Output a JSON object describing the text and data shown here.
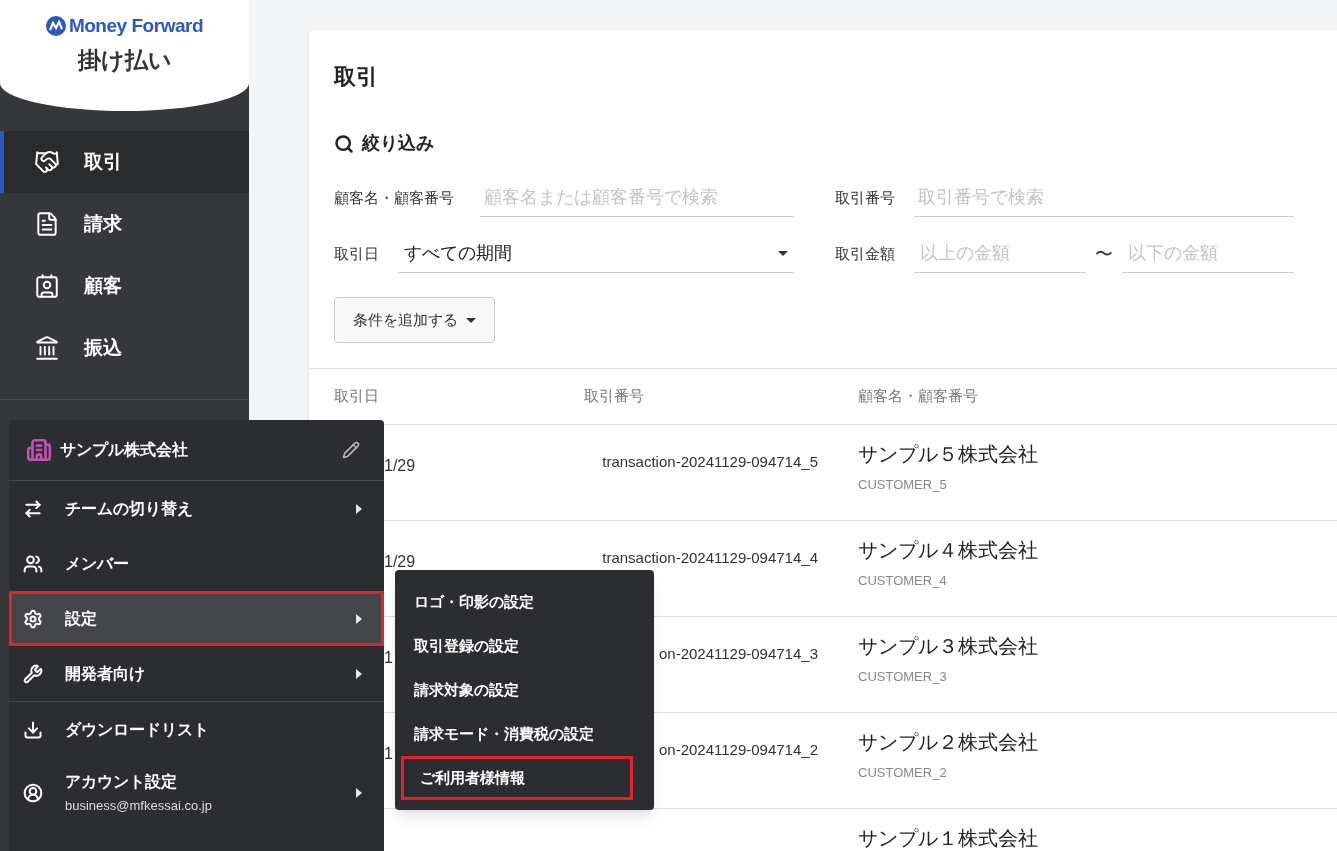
{
  "brand": {
    "logo_text": "Money Forward",
    "product": "掛け払い"
  },
  "sidebar": {
    "items": [
      {
        "label": "取引",
        "selected": true
      },
      {
        "label": "請求",
        "selected": false
      },
      {
        "label": "顧客",
        "selected": false
      },
      {
        "label": "振込",
        "selected": false
      }
    ]
  },
  "page": {
    "title": "取引"
  },
  "filters": {
    "heading": "絞り込み",
    "customer": {
      "label": "顧客名・顧客番号",
      "placeholder": "顧客名または顧客番号で検索"
    },
    "transaction_number": {
      "label": "取引番号",
      "placeholder": "取引番号で検索"
    },
    "date": {
      "label": "取引日",
      "value": "すべての期間"
    },
    "amount": {
      "label": "取引金額",
      "min_placeholder": "以上の金額",
      "separator": "〜",
      "max_placeholder": "以下の金額"
    },
    "add_condition_button": "条件を追加する"
  },
  "table": {
    "columns": [
      "取引日",
      "取引番号",
      "顧客名・顧客番号"
    ],
    "rows": [
      {
        "date": "1/29",
        "transaction_number": "transaction-20241129-094714_5",
        "customer_name": "サンプル５株式会社",
        "customer_code": "CUSTOMER_5"
      },
      {
        "date": "1/29",
        "transaction_number": "transaction-20241129-094714_4",
        "customer_name": "サンプル４株式会社",
        "customer_code": "CUSTOMER_4"
      },
      {
        "date": "1",
        "transaction_number": "on-20241129-094714_3",
        "customer_name": "サンプル３株式会社",
        "customer_code": "CUSTOMER_3"
      },
      {
        "date": "1",
        "transaction_number": "on-20241129-094714_2",
        "customer_name": "サンプル２株式会社",
        "customer_code": "CUSTOMER_2"
      },
      {
        "customer_name": "サンプル１株式会社"
      }
    ]
  },
  "account_menu": {
    "company": "サンプル株式会社",
    "groups": [
      [
        {
          "label": "チームの切り替え",
          "has_submenu": true,
          "highlighted": false,
          "annotated": false
        },
        {
          "label": "メンバー",
          "has_submenu": false,
          "highlighted": false,
          "annotated": false
        },
        {
          "label": "設定",
          "has_submenu": true,
          "highlighted": true,
          "annotated": true
        },
        {
          "label": "開発者向け",
          "has_submenu": true,
          "highlighted": false,
          "annotated": false
        }
      ],
      [
        {
          "label": "ダウンロードリスト",
          "has_submenu": false,
          "highlighted": false,
          "annotated": false
        },
        {
          "label": "アカウント設定",
          "sublabel": "business@mfkessai.co.jp",
          "has_submenu": true,
          "highlighted": false,
          "annotated": false
        }
      ]
    ]
  },
  "submenu": {
    "items": [
      {
        "label": "ロゴ・印影の設定",
        "annotated": false
      },
      {
        "label": "取引登録の設定",
        "annotated": false
      },
      {
        "label": "請求対象の設定",
        "annotated": false
      },
      {
        "label": "請求モード・消費税の設定",
        "annotated": false
      },
      {
        "label": "ご利用者様情報",
        "annotated": true
      }
    ]
  }
}
